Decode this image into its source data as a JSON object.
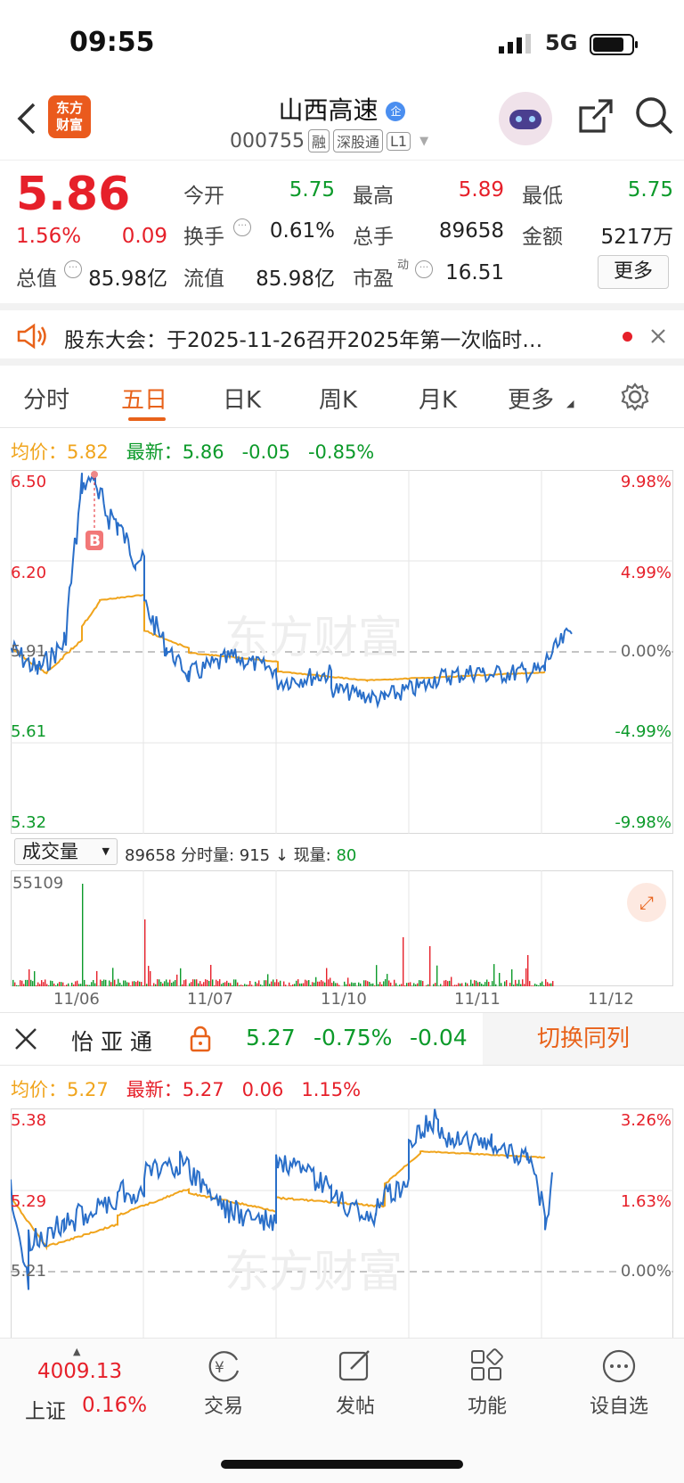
{
  "status": {
    "time": "09:55",
    "network": "5G"
  },
  "header": {
    "logo_text": "东方\n财富",
    "title": "山西高速",
    "title_badge": "企",
    "code": "000755",
    "tags": [
      "融",
      "深股通",
      "L1"
    ]
  },
  "quote": {
    "price": "5.86",
    "change_pct": "1.56%",
    "change": "0.09",
    "rows": [
      [
        [
          "今开",
          "5.75",
          "green"
        ],
        [
          "最高",
          "5.89",
          "red"
        ],
        [
          "最低",
          "5.75",
          "green"
        ]
      ],
      [
        [
          "换手",
          "0.61%",
          ""
        ],
        [
          "总手",
          "89658",
          ""
        ],
        [
          "金额",
          "5217万",
          ""
        ]
      ],
      [
        [
          "总值",
          "85.98亿",
          ""
        ],
        [
          "流值",
          "85.98亿",
          ""
        ],
        [
          "市盈",
          "16.51",
          ""
        ]
      ]
    ],
    "pe_sup": "动",
    "more_label": "更多"
  },
  "notice": {
    "text": "股东大会：于2025-11-26召开2025年第一次临时…"
  },
  "tabs": [
    "分时",
    "五日",
    "日K",
    "周K",
    "月K",
    "更多"
  ],
  "active_tab": 1,
  "chart1": {
    "avg_label": "均价：",
    "avg": "5.82",
    "latest_label": "最新：",
    "latest": "5.86",
    "latest_chg": "-0.05",
    "latest_pct": "-0.85%",
    "y_left": [
      "6.50",
      "6.20",
      "5.91",
      "5.61",
      "5.32"
    ],
    "y_right": [
      "9.98%",
      "4.99%",
      "0.00%",
      "-4.99%",
      "-9.98%"
    ],
    "volume_selector": "成交量",
    "volume_info": "89658 分时量: 915 ↓ 现量: ",
    "volume_now": "80",
    "volume_max": "55109",
    "dates": [
      "11/06",
      "11/07",
      "11/10",
      "11/11",
      "11/12"
    ],
    "buy_marker": "B"
  },
  "compare": {
    "name": "怡 亚 通",
    "price": "5.27",
    "pct": "-0.75%",
    "chg": "-0.04",
    "switch_label": "切换同列",
    "avg_label": "均价：",
    "avg": "5.27",
    "latest_label": "最新：",
    "latest": "5.27",
    "latest_chg": "0.06",
    "latest_pct": "1.15%",
    "y_left": [
      "5.38",
      "5.29",
      "5.21"
    ],
    "y_right": [
      "3.26%",
      "1.63%",
      "0.00%"
    ]
  },
  "watermark": "东方财富",
  "bottom": {
    "index_value": "4009.13",
    "index_name": "上证",
    "index_pct": "0.16%",
    "items": [
      "交易",
      "发帖",
      "功能",
      "设自选"
    ]
  },
  "colors": {
    "up": "#e6202a",
    "down": "#0c9a2a",
    "accent": "#e8621a",
    "line": "#2a6fc9",
    "avg": "#f0a41c"
  }
}
